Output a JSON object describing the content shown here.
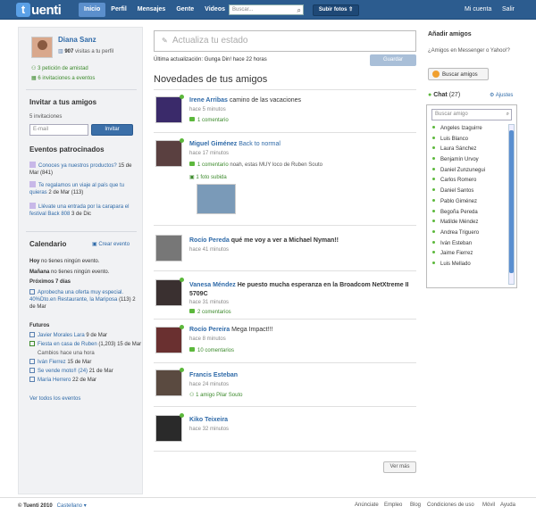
{
  "brand": {
    "logo_letter": "t",
    "logo_rest": "uenti"
  },
  "nav": {
    "items": [
      "Inicio",
      "Perfil",
      "Mensajes",
      "Gente",
      "Videos"
    ]
  },
  "search": {
    "placeholder": "Buscar..."
  },
  "upload": {
    "label": "Subir fotos"
  },
  "top_right": {
    "account": "Mi cuenta",
    "logout": "Salir"
  },
  "profile": {
    "name": "Diana Sanz",
    "visits_count": "907",
    "visits_text": "visitas a tu perfil",
    "friend_requests": "3 petición de amistad",
    "event_invites": "6 invitaciones a eventos"
  },
  "invite": {
    "title": "Invitar a tus amigos",
    "count": "5 invitaciones",
    "email_placeholder": "E-mail",
    "button": "Invitar"
  },
  "sponsored": {
    "title": "Eventos patrocinados",
    "items": [
      {
        "text": "Conoces ya nuestros productos?",
        "date": "15 de Mar (841)"
      },
      {
        "text": "Te regalamos un viaje al país que tu quieras",
        "date": "2 de Mar (113)"
      },
      {
        "text": "Llévate una entrada por la carapara el festival Back 808",
        "date": "3 de Dic"
      }
    ]
  },
  "calendar": {
    "title": "Calendario",
    "create": "Crear evento",
    "today_label": "Hoy",
    "today_text": "no tienes ningún evento.",
    "tomorrow_label": "Mañana",
    "tomorrow_text": "no tienes ningún evento.",
    "next7": "Próximos 7 días",
    "next7_item_title": "Aprobecha una oferta muy especial. 40%Dto.en Restaurante, la Mariposa",
    "next7_item_date": "(113)  2 de Mar",
    "futures": "Futuros",
    "future_items": [
      {
        "title": "Javier Morales Lara",
        "date": "9 de Mar"
      },
      {
        "title": "Fiesta en casa de Ruben",
        "date": "(1,203) 15 de Mar"
      },
      {
        "title": "Cambios hace una hora",
        "date": ""
      },
      {
        "title": "Iván Fierrez",
        "date": "15 de Mar"
      },
      {
        "title": "Se vende moto!! (24)",
        "date": "21 de Mar"
      },
      {
        "title": "María Herrero",
        "date": "22 de Mar"
      }
    ],
    "all": "Ver todos los eventos"
  },
  "status": {
    "placeholder": "Actualiza tu estado",
    "last_update": "Última actualización: Gunga Din! hace 22 horas",
    "save": "Guardar"
  },
  "feed": {
    "title": "Novedades de tus amigos",
    "items": [
      {
        "name": "Irene Arribas",
        "text": "camino de las vacaciones",
        "time": "hace 5 minutos",
        "extra": "1 comentario"
      },
      {
        "name": "Miguel Giménez",
        "text": "Back to normal",
        "time": "hace 17 minutos",
        "extra": "1 comentario",
        "extra2": "noah, estas MUY loco de Ruben Souto",
        "photo": "1 foto subida"
      },
      {
        "name": "Rocío Pereda",
        "text": "qué me voy a ver a Michael Nyman!!",
        "time": "hace 41 minutos",
        "extra": ""
      },
      {
        "name": "Vanesa Méndez",
        "text": "He puesto mucha esperanza en la Broadcom NetXtreme II 5709C",
        "time": "hace 31 minutos",
        "extra": "2 comentarios"
      },
      {
        "name": "Rocío Pereira",
        "text": "Mega Impact!!!",
        "time": "hace 8 minutos",
        "extra": "10 comentarios"
      },
      {
        "name": "Francis Esteban",
        "text": "",
        "time": "hace 24 minutos",
        "extra": "1 amigo",
        "extra2": "Pilar Souto"
      },
      {
        "name": "Kiko Teixeira",
        "text": "",
        "time": "hace 32 minutos",
        "extra": ""
      }
    ],
    "more": "Ver más"
  },
  "right": {
    "add_friends_title": "Añadir amigos",
    "add_friends_text": "¿Amigos en Messenger o Yahoo!?",
    "search_friends_btn": "Buscar amigos",
    "chat_title": "Chat",
    "chat_count": "(27)",
    "settings": "Ajustes",
    "chat_search_placeholder": "Buscar amigo",
    "chat_people": [
      "Angeles Izaguirre",
      "Luis Blanco",
      "Laura Sánchez",
      "Benjamín Urvoy",
      "Daniel Zunzunegui",
      "Carlos Romero",
      "Daniel Santos",
      "Pablo Giménez",
      "Begoña Pereda",
      "Matilde Méndez",
      "Andrea Triguero",
      "Iván Esteban",
      "Jaime Fierrez",
      "Luis Mellado"
    ]
  },
  "footer": {
    "copyright": "© Tuenti 2010",
    "language": "Castellano",
    "links": [
      "Anúnciate",
      "Empleo",
      "Blog",
      "Condiciones de uso",
      "Móvil",
      "Ayuda"
    ]
  },
  "colors": {
    "topbar": "#2c5c8f",
    "link": "#2f6aa8",
    "green": "#3c8a2c"
  }
}
